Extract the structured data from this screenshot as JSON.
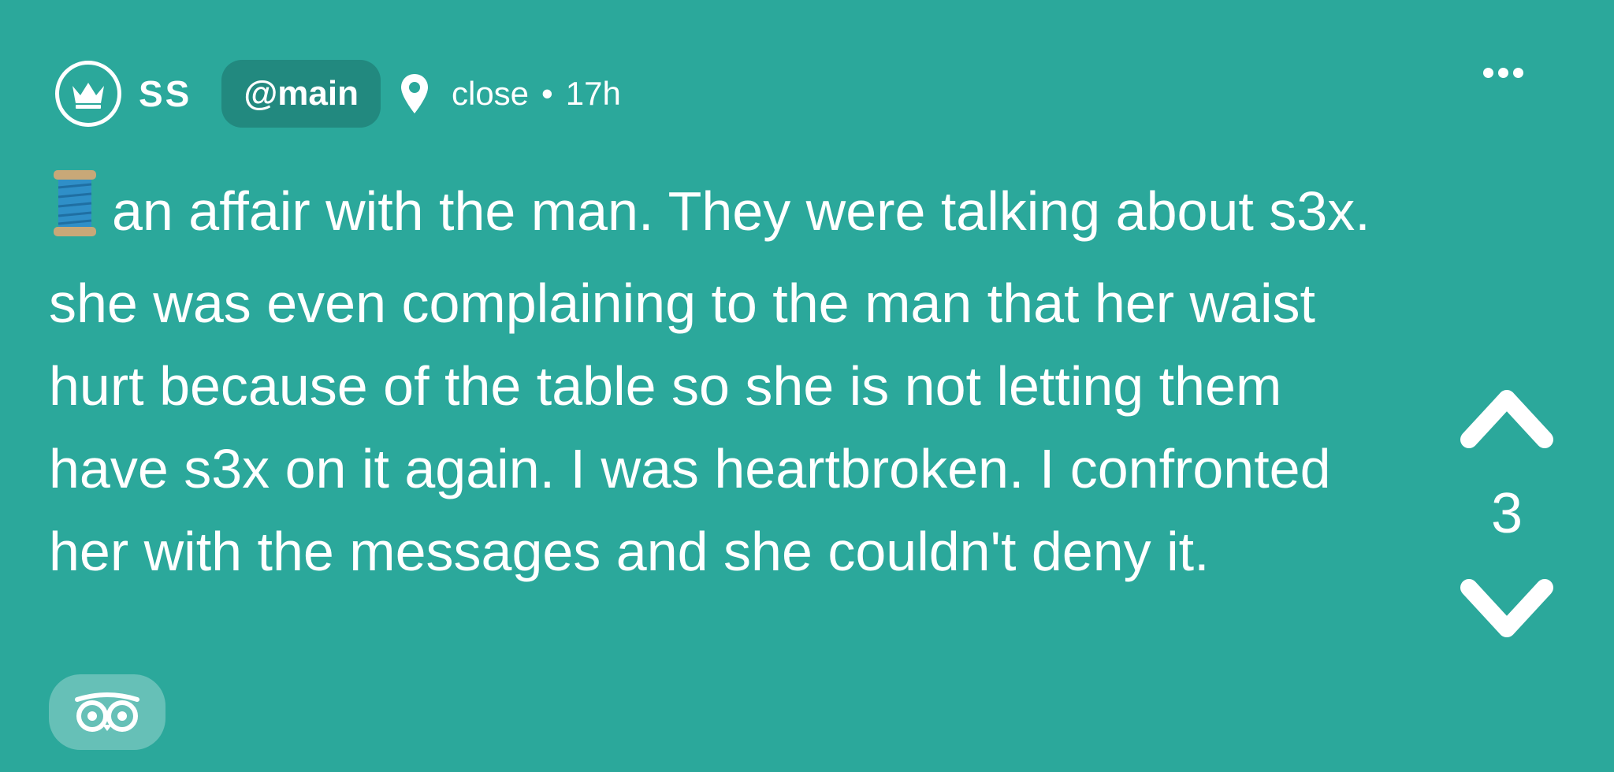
{
  "post": {
    "username": "SS",
    "channel": "@main",
    "location": "close",
    "separator": "•",
    "age": "17h",
    "body": "an affair with the man. They were talking about s3x. she was even complaining to the man that her waist hurt because of the table so she is not letting them have s3x on it again. I was heartbroken. I confronted her with the messages and she couldn't deny it.",
    "votes": "3"
  },
  "icons": {
    "avatar": "crown-icon",
    "location": "map-pin-icon",
    "more": "ellipsis-icon",
    "emoji": "thread-spool-icon",
    "upvote": "chevron-up-icon",
    "downvote": "chevron-down-icon",
    "owl": "owl-icon"
  },
  "colors": {
    "background": "#2ba89b",
    "pill": "#22897f",
    "text": "#ffffff"
  }
}
